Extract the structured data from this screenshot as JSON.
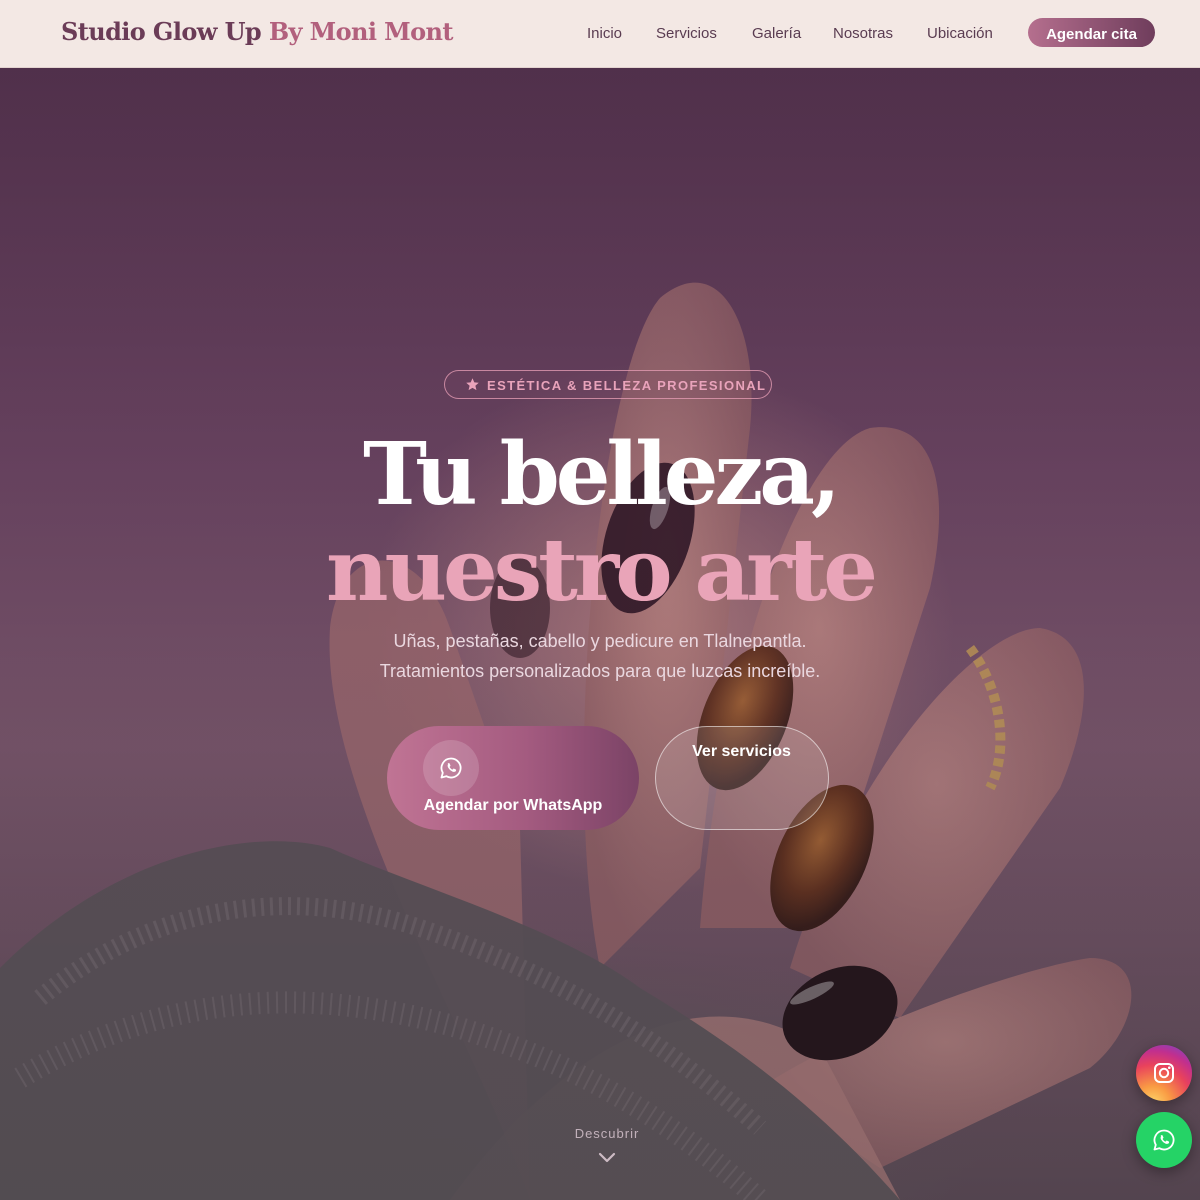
{
  "brand": {
    "part1": "Studio Glow Up",
    "part2": "By Moni Mont"
  },
  "nav": {
    "links": [
      "Inicio",
      "Servicios",
      "Galería",
      "Nosotras",
      "Ubicación"
    ],
    "cta_label": "Agendar cita"
  },
  "hero": {
    "badge_icon": "star-icon",
    "badge_text": "ESTÉTICA & BELLEZA PROFESIONAL",
    "headline_line1": "Tu belleza,",
    "headline_line2": "nuestro arte",
    "subtitle_line1": "Uñas, pestañas, cabello y pedicure en Tlalnepantla.",
    "subtitle_line2": "Tratamientos personalizados para que luzcas increíble.",
    "primary_button": {
      "icon": "whatsapp-icon",
      "label": "Agendar por WhatsApp"
    },
    "secondary_button": {
      "label": "Ver servicios"
    },
    "scroll_hint": "Descubrir",
    "scroll_icon": "chevron-down-icon"
  },
  "floating": {
    "instagram_icon": "instagram-icon",
    "whatsapp_icon": "whatsapp-icon"
  },
  "colors": {
    "nav_background": "#f3e8e4",
    "brand_primary": "#6b3c57",
    "brand_accent": "#b2607d",
    "headline_accent": "#e9a4b8",
    "whatsapp_green": "#25d366"
  }
}
